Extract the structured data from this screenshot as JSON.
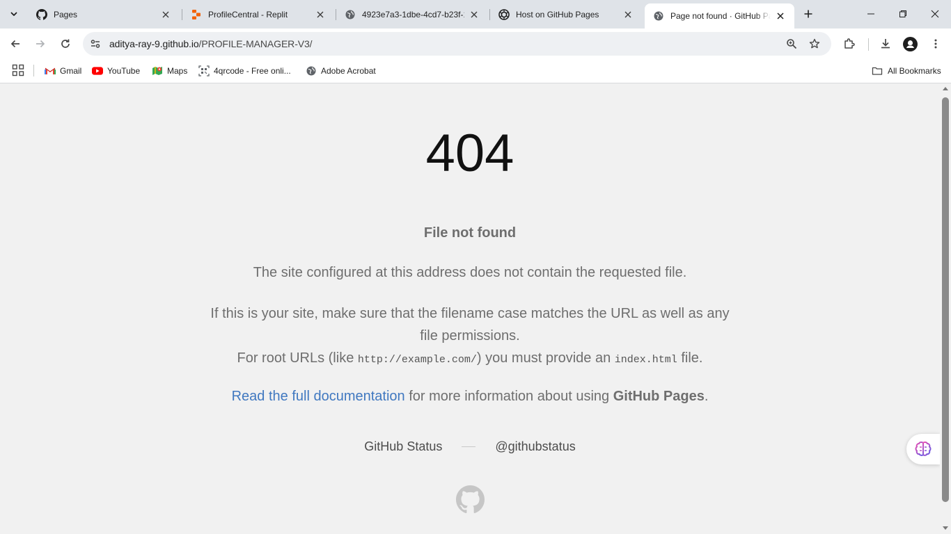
{
  "tabs": [
    {
      "title": "Pages",
      "icon": "github-icon",
      "active": false
    },
    {
      "title": "ProfileCentral - Replit",
      "icon": "replit-icon",
      "active": false
    },
    {
      "title": "4923e7a3-1dbe-4cd7-b23f-1",
      "icon": "globe-icon",
      "active": false
    },
    {
      "title": "Host on GitHub Pages",
      "icon": "chatgpt-icon",
      "active": false
    },
    {
      "title": "Page not found · GitHub Pag",
      "icon": "globe-icon",
      "active": true
    }
  ],
  "toolbar": {
    "url_host": "aditya-ray-9.github.io",
    "url_path": "/PROFILE-MANAGER-V3/"
  },
  "bookmarks": [
    {
      "label": "Gmail",
      "icon": "gmail-icon"
    },
    {
      "label": "YouTube",
      "icon": "youtube-icon"
    },
    {
      "label": "Maps",
      "icon": "maps-icon"
    },
    {
      "label": "4qrcode - Free onli...",
      "icon": "qrcode-icon"
    },
    {
      "label": "Adobe Acrobat",
      "icon": "globe-icon"
    }
  ],
  "all_bookmarks_label": "All Bookmarks",
  "page": {
    "code": "404",
    "heading": "File not found",
    "para1": "The site configured at this address does not contain the requested file.",
    "para2_line1": "If this is your site, make sure that the filename case matches the URL as well as any file permissions.",
    "para2_line2_a": "For root URLs (like ",
    "para2_code1": "http://example.com/",
    "para2_line2_b": ") you must provide an ",
    "para2_code2": "index.html",
    "para2_line2_c": " file.",
    "para3_link": "Read the full documentation",
    "para3_mid": " for more information about using ",
    "para3_strong": "GitHub Pages",
    "para3_end": ".",
    "status_link": "GitHub Status",
    "twitter_link": "@githubstatus"
  },
  "colors": {
    "link": "#4078c0",
    "active_tab": "#ffffff",
    "tab_strip": "#dfe3e8",
    "page_bg": "#f1f1f1"
  }
}
